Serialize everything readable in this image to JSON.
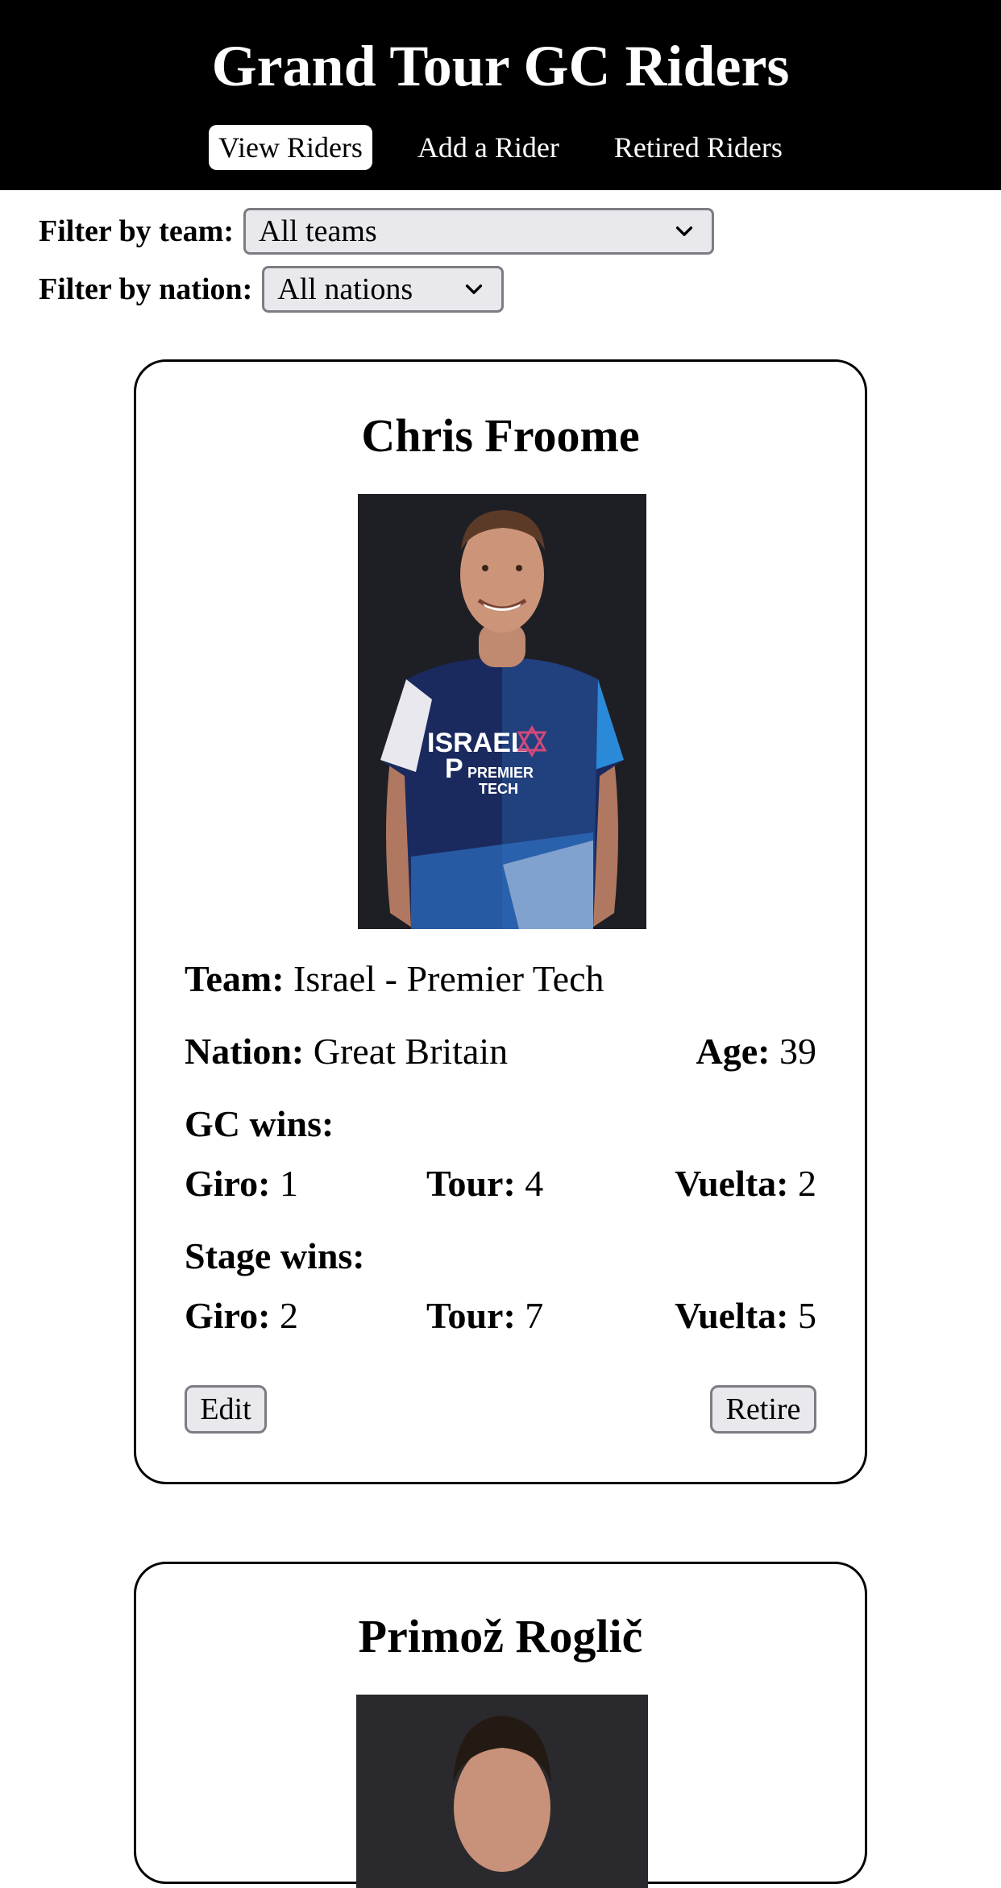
{
  "header": {
    "title": "Grand Tour GC Riders",
    "nav": [
      {
        "label": "View Riders",
        "active": true
      },
      {
        "label": "Add a Rider",
        "active": false
      },
      {
        "label": "Retired Riders",
        "active": false
      }
    ]
  },
  "filters": {
    "team": {
      "label": "Filter by team:",
      "value": "All teams"
    },
    "nation": {
      "label": "Filter by nation:",
      "value": "All nations"
    }
  },
  "labels": {
    "team": "Team:",
    "nation": "Nation:",
    "age": "Age:",
    "gc_wins": "GC wins:",
    "stage_wins": "Stage wins:",
    "giro": "Giro:",
    "tour": "Tour:",
    "vuelta": "Vuelta:",
    "edit": "Edit",
    "retire": "Retire"
  },
  "riders": [
    {
      "name": "Chris Froome",
      "team": "Israel - Premier Tech",
      "nation": "Great Britain",
      "age": "39",
      "gc": {
        "giro": "1",
        "tour": "4",
        "vuelta": "2"
      },
      "stages": {
        "giro": "2",
        "tour": "7",
        "vuelta": "5"
      },
      "jersey_text": [
        "ISRAEL",
        "PREMIER",
        "TECH"
      ]
    },
    {
      "name": "Primož Roglič"
    }
  ],
  "colors": {
    "header_bg": "#000000",
    "select_bg": "#e8e8ed",
    "jersey_dark": "#1a2a5e",
    "jersey_light": "#2a8ad8"
  }
}
